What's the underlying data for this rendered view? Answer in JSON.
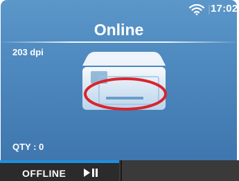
{
  "status_bar": {
    "time": "17:02",
    "wifi_icon": "wifi-icon"
  },
  "main": {
    "title": "Online",
    "resolution": "203 dpi",
    "quantity": "QTY : 0",
    "printer_icon": "printer-icon",
    "annotation_color": "#d8242c"
  },
  "softkeys": {
    "left_label": "OFFLINE",
    "left_icon": "play-pause-icon",
    "accent": "#1f8fe0"
  }
}
